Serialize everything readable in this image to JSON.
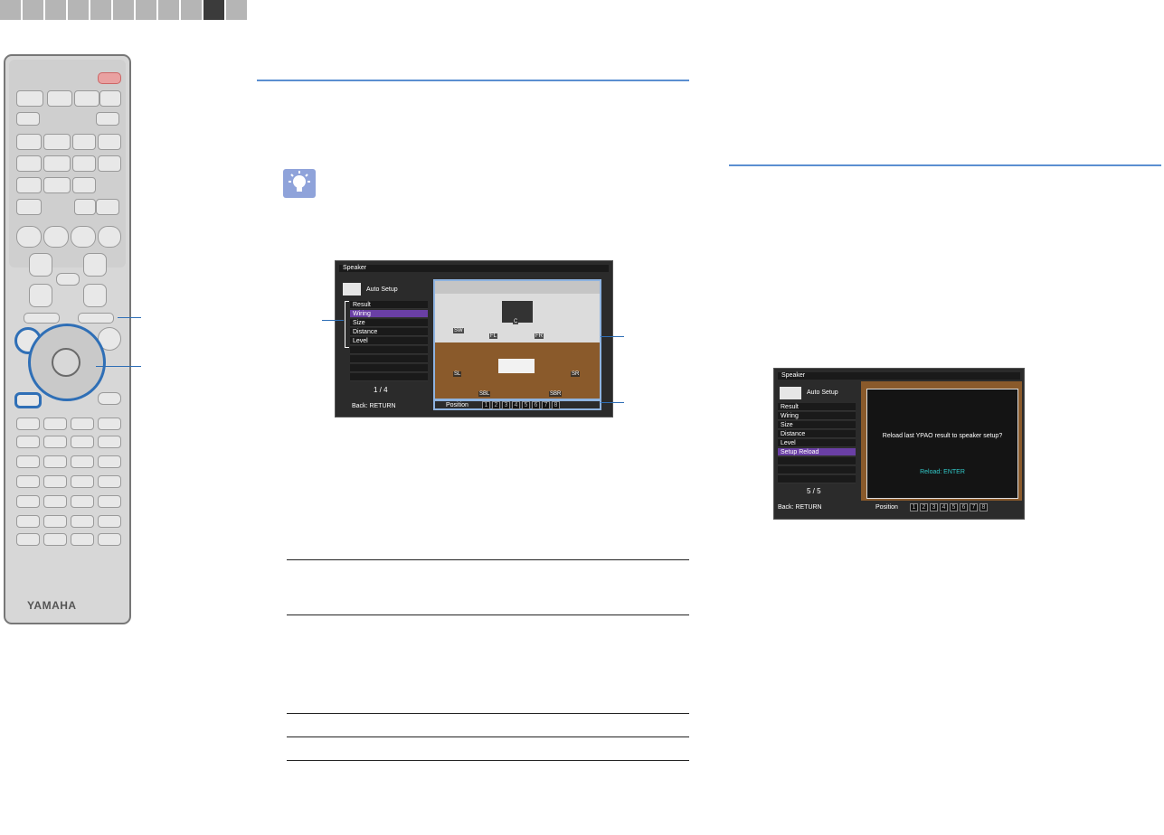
{
  "tabs": {
    "count": 11,
    "active_index": 9
  },
  "remote": {
    "brand": "YAMAHA"
  },
  "screen1": {
    "title": "Speaker",
    "auto_setup": "Auto Setup",
    "menu": [
      "Result",
      "Wiring",
      "Size",
      "Distance",
      "Level"
    ],
    "selected_index": 1,
    "page": "1 / 4",
    "back": "Back: RETURN",
    "position_label": "Position",
    "positions": [
      "1",
      "2",
      "3",
      "4",
      "5",
      "6",
      "7",
      "8"
    ],
    "speakers": [
      "C",
      "SW",
      "FL",
      "FR",
      "SL",
      "SR",
      "SBL",
      "SBR"
    ]
  },
  "screen2": {
    "title": "Speaker",
    "auto_setup": "Auto Setup",
    "menu": [
      "Result",
      "Wiring",
      "Size",
      "Distance",
      "Level",
      "Setup Reload"
    ],
    "selected_index": 5,
    "page": "5 / 5",
    "back": "Back: RETURN",
    "position_label": "Position",
    "positions": [
      "1",
      "2",
      "3",
      "4",
      "5",
      "6",
      "7",
      "8"
    ],
    "message": "Reload last YPAO result to speaker setup?",
    "action": "Reload: ENTER"
  }
}
